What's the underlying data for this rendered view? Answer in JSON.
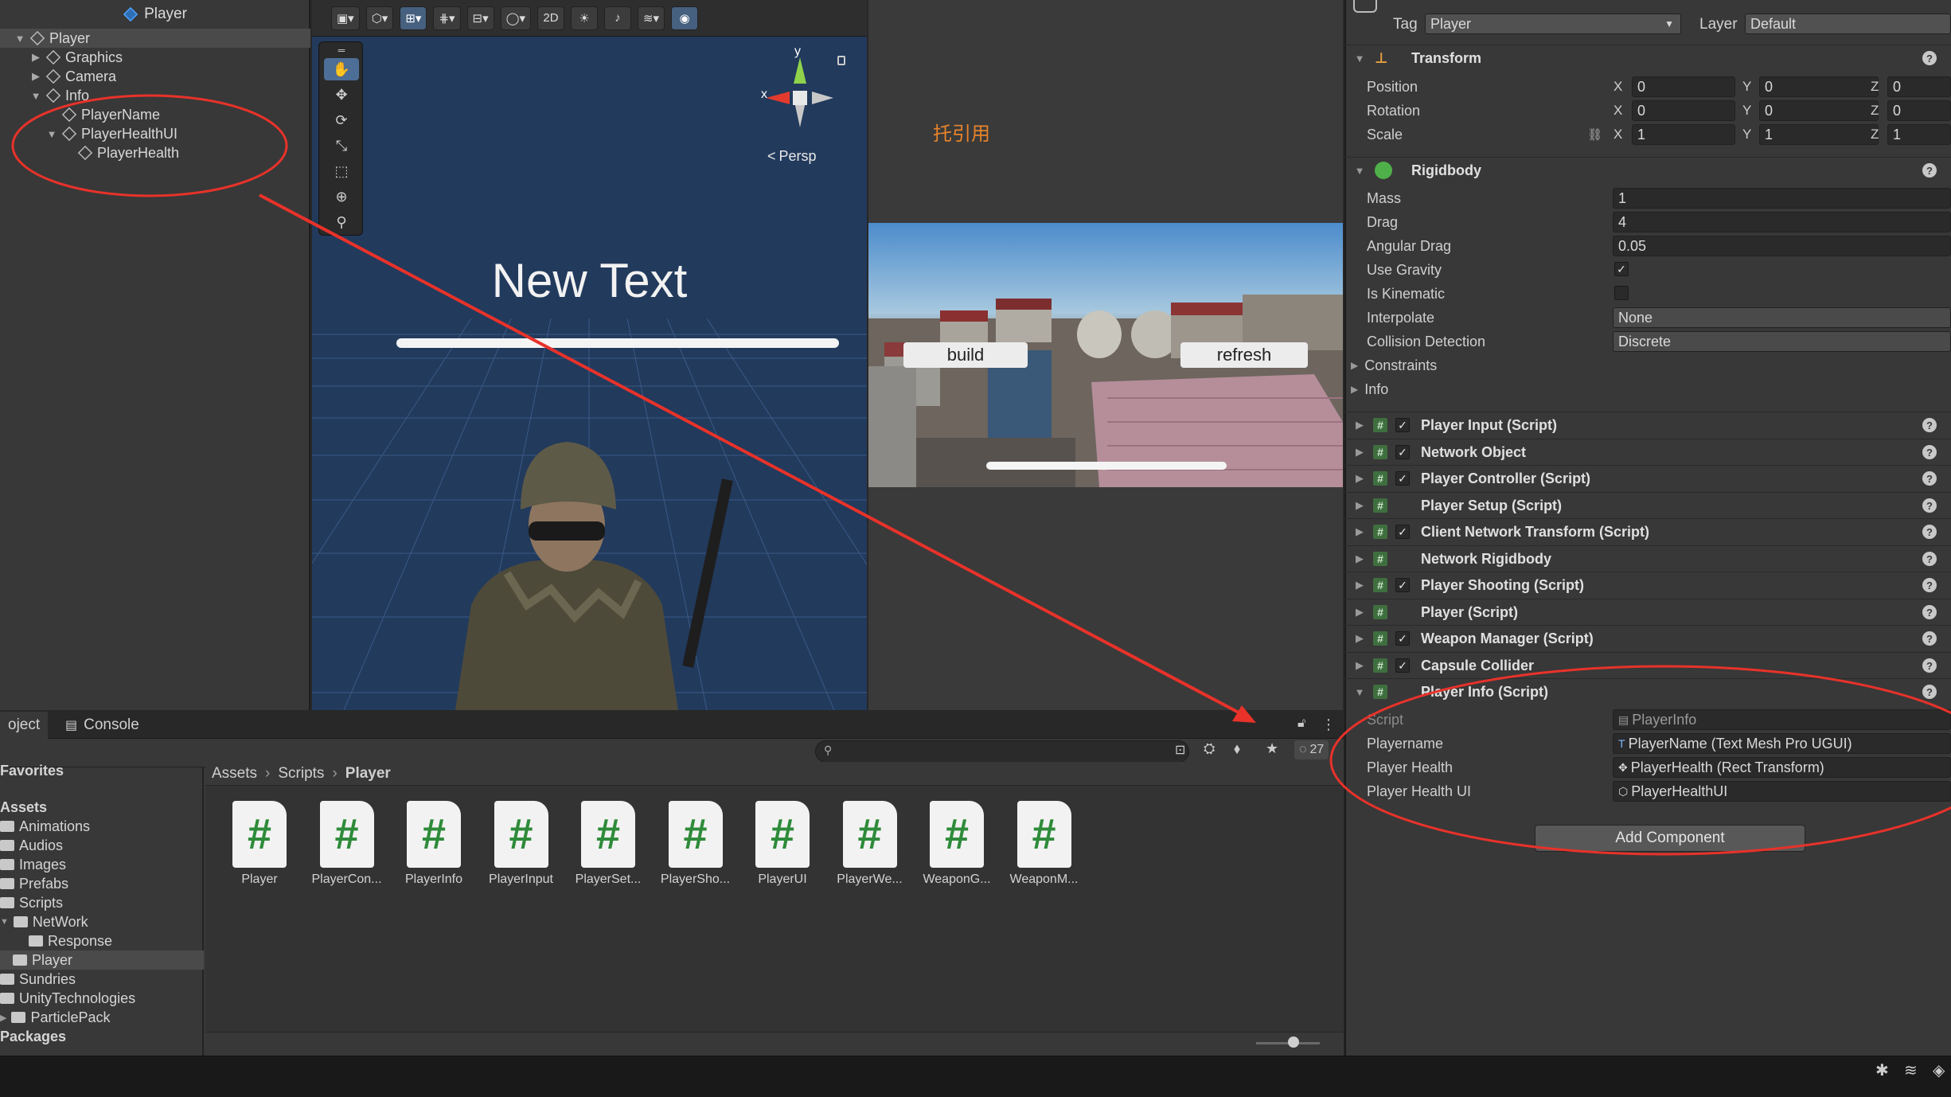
{
  "hierarchy": {
    "title": "Player",
    "nodes": [
      "Player",
      "Graphics",
      "Camera",
      "Info",
      "PlayerName",
      "PlayerHealthUI",
      "PlayerHealth"
    ]
  },
  "scene": {
    "toolbar_2d_label": "2D",
    "gizmo_y": "y",
    "gizmo_x": "x",
    "persp_label": "Persp",
    "new_text": "New Text"
  },
  "game": {
    "annotation": "托引用",
    "build_label": "build",
    "refresh_label": "refresh"
  },
  "inspector": {
    "tag_label": "Tag",
    "tag_value": "Player",
    "layer_label": "Layer",
    "layer_value": "Default",
    "transform": {
      "title": "Transform",
      "rows": [
        {
          "label": "Position",
          "x": "0",
          "y": "0",
          "z": "0"
        },
        {
          "label": "Rotation",
          "x": "0",
          "y": "0",
          "z": "0"
        },
        {
          "label": "Scale",
          "x": "1",
          "y": "1",
          "z": "1"
        }
      ],
      "axis_x": "X",
      "axis_y": "Y",
      "axis_z": "Z"
    },
    "rigidbody": {
      "title": "Rigidbody",
      "mass_label": "Mass",
      "mass": "1",
      "drag_label": "Drag",
      "drag": "4",
      "angular_drag_label": "Angular Drag",
      "angular_drag": "0.05",
      "use_gravity_label": "Use Gravity",
      "use_gravity": true,
      "is_kinematic_label": "Is Kinematic",
      "is_kinematic": false,
      "interpolate_label": "Interpolate",
      "interpolate": "None",
      "collision_label": "Collision Detection",
      "collision": "Discrete",
      "constraints_label": "Constraints",
      "info_label": "Info"
    },
    "components": [
      {
        "name": "Player Input (Script)",
        "checked": true
      },
      {
        "name": "Network Object",
        "checked": true
      },
      {
        "name": "Player Controller (Script)",
        "checked": true
      },
      {
        "name": "Player Setup (Script)",
        "checked": false
      },
      {
        "name": "Client Network Transform (Script)",
        "checked": true
      },
      {
        "name": "Network Rigidbody",
        "checked": false
      },
      {
        "name": "Player Shooting (Script)",
        "checked": true
      },
      {
        "name": "Player (Script)",
        "checked": false
      },
      {
        "name": "Weapon Manager (Script)",
        "checked": true
      },
      {
        "name": "Capsule Collider",
        "checked": true
      },
      {
        "name": "Player Info (Script)",
        "checked": false
      }
    ],
    "player_info": {
      "script_label": "Script",
      "script_value": "PlayerInfo",
      "playername_label": "Playername",
      "playername_value": "PlayerName (Text Mesh Pro UGUI)",
      "player_health_label": "Player Health",
      "player_health_value": "PlayerHealth (Rect Transform)",
      "player_health_ui_label": "Player Health UI",
      "player_health_ui_value": "PlayerHealthUI"
    },
    "add_component": "Add Component"
  },
  "project": {
    "tab_project": "oject",
    "tab_console": "Console",
    "hidden_count": "27",
    "breadcrumb": [
      "Assets",
      "Scripts",
      "Player"
    ],
    "folders": [
      "Favorites",
      "Assets",
      "Animations",
      "Audios",
      "Images",
      "Prefabs",
      "Scripts",
      "NetWork",
      "Response",
      "Player",
      "Sundries",
      "UnityTechnologies",
      "ParticlePack",
      "Packages"
    ],
    "assets": [
      "Player",
      "PlayerCon...",
      "PlayerInfo",
      "PlayerInput",
      "PlayerSet...",
      "PlayerSho...",
      "PlayerUI",
      "PlayerWe...",
      "WeaponG...",
      "WeaponM..."
    ]
  },
  "colors": {
    "annotation_red": "#e8322a",
    "selection": "#4a4a4a",
    "script_icon_green": "#2e8b3a"
  }
}
